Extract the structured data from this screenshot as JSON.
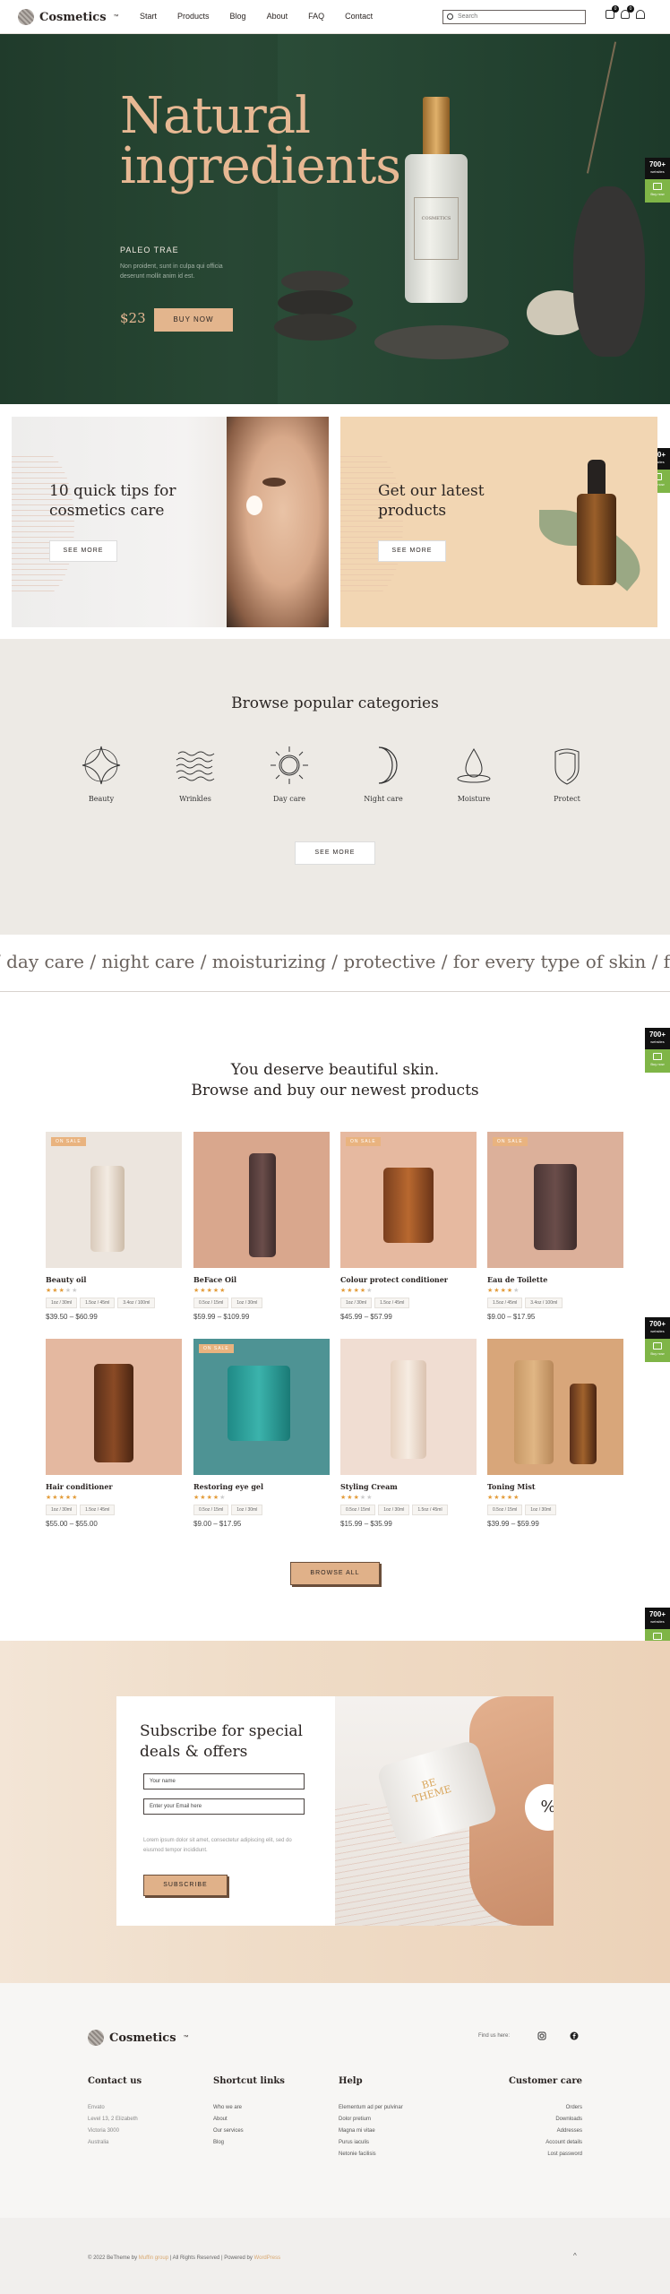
{
  "header": {
    "logo_text": "Cosmetics",
    "logo_tm": "™",
    "nav": [
      "Start",
      "Products",
      "Blog",
      "About",
      "FAQ",
      "Contact"
    ],
    "search_placeholder": "Search",
    "cart_count": "0",
    "wishlist_count": "0"
  },
  "hero": {
    "title_line1": "Natural",
    "title_line2": "ingredients",
    "brand": "PALEO TRAE",
    "description": "Non proident, sunt in culpa qui officia deserunt mollit anim id est.",
    "price": "$23",
    "button": "BUY NOW",
    "bottle_label": "COSMETICS"
  },
  "side_badge": {
    "count": "700+",
    "count_sub": "websites",
    "buy": "Buy now"
  },
  "promos": [
    {
      "title": "10 quick tips for cosmetics care",
      "button": "SEE MORE"
    },
    {
      "title": "Get our latest products",
      "button": "SEE MORE"
    }
  ],
  "categories": {
    "title": "Browse popular categories",
    "items": [
      {
        "label": "Beauty",
        "icon": "star-diamond-icon"
      },
      {
        "label": "Wrinkles",
        "icon": "waves-icon"
      },
      {
        "label": "Day care",
        "icon": "sun-icon"
      },
      {
        "label": "Night care",
        "icon": "moon-icon"
      },
      {
        "label": "Moisture",
        "icon": "drop-icon"
      },
      {
        "label": "Protect",
        "icon": "shield-icon"
      }
    ],
    "button": "SEE MORE"
  },
  "marquee": "/ day care / night care / moisturizing / protective / for every type of skin / for him / f",
  "products": {
    "title_line1": "You deserve beautiful skin.",
    "title_line2": "Browse and buy our newest products",
    "items": [
      {
        "name": "Beauty oil",
        "badge": "ON SALE",
        "rating": 3,
        "options": [
          "1oz / 30ml",
          "1.5oz / 45ml",
          "3.4oz / 100ml"
        ],
        "price": "$39.50 – $60.99",
        "bg": "#ece5de"
      },
      {
        "name": "BeFace Oil",
        "badge": "",
        "rating": 5,
        "options": [
          "0.5oz / 15ml",
          "1oz / 30ml"
        ],
        "price": "$59.99 – $109.99",
        "bg": "#d9a78d"
      },
      {
        "name": "Colour protect conditioner",
        "badge": "ON SALE",
        "rating": 4,
        "options": [
          "1oz / 30ml",
          "1.5oz / 45ml"
        ],
        "price": "$45.99 – $57.99",
        "bg": "#e6b9a0"
      },
      {
        "name": "Eau de Toilette",
        "badge": "ON SALE",
        "rating": 4,
        "options": [
          "1.5oz / 45ml",
          "3.4oz / 100ml"
        ],
        "price": "$9.00 – $17.95",
        "bg": "#dcb09a"
      },
      {
        "name": "Hair conditioner",
        "badge": "",
        "rating": 5,
        "options": [
          "1oz / 30ml",
          "1.5oz / 45ml"
        ],
        "price": "$55.00 – $55.00",
        "bg": "#e4b8a0"
      },
      {
        "name": "Restoring eye gel",
        "badge": "ON SALE",
        "rating": 4,
        "options": [
          "0.5oz / 15ml",
          "1oz / 30ml"
        ],
        "price": "$9.00 – $17.95",
        "bg": "#4e9394"
      },
      {
        "name": "Styling Cream",
        "badge": "",
        "rating": 3,
        "options": [
          "0.5oz / 15ml",
          "1oz / 30ml",
          "1.5oz / 45ml"
        ],
        "price": "$15.99 – $35.99",
        "bg": "#f0ddd2"
      },
      {
        "name": "Toning Mist",
        "badge": "",
        "rating": 5,
        "options": [
          "0.5oz / 15ml",
          "1oz / 30ml"
        ],
        "price": "$39.99 – $59.99",
        "bg": "#d8a67a"
      }
    ],
    "button": "BROWSE ALL"
  },
  "subscribe": {
    "title_line1": "Subscribe for special",
    "title_line2": "deals & offers",
    "name_placeholder": "Your name",
    "email_placeholder": "Enter your Email here",
    "note": "Lorem ipsum dolor sit amet, consectetur adipiscing elit, sed do eiusmod tempor incididunt.",
    "button": "SUBSCRIBE",
    "jar_label_1": "BE",
    "jar_label_2": "THEME",
    "percent": "%"
  },
  "footer": {
    "logo_text": "Cosmetics",
    "logo_tm": "™",
    "find_us": "Find us here:",
    "contact_title": "Contact us",
    "contact_lines": [
      "Envato",
      "Level 13, 2 Elizabeth",
      "Victoria 3000",
      "Australia"
    ],
    "shortcuts_title": "Shortcut links",
    "shortcuts": [
      "Who we are",
      "About",
      "Our services",
      "Blog"
    ],
    "help_title": "Help",
    "help": [
      "Elementum ad per pulvinar",
      "Dolor pretium",
      "Magna mi vitae",
      "Purus iaculis",
      "Netonie facilisis"
    ],
    "care_title": "Customer care",
    "care": [
      "Orders",
      "Downloads",
      "Addresses",
      "Account details",
      "Lost password"
    ],
    "copy_a": "© 2022 BeTheme by ",
    "copy_b": "Muffin group",
    "copy_c": " | All Rights Reserved | Powered by ",
    "copy_d": "WordPress",
    "top_arrow": "^"
  }
}
